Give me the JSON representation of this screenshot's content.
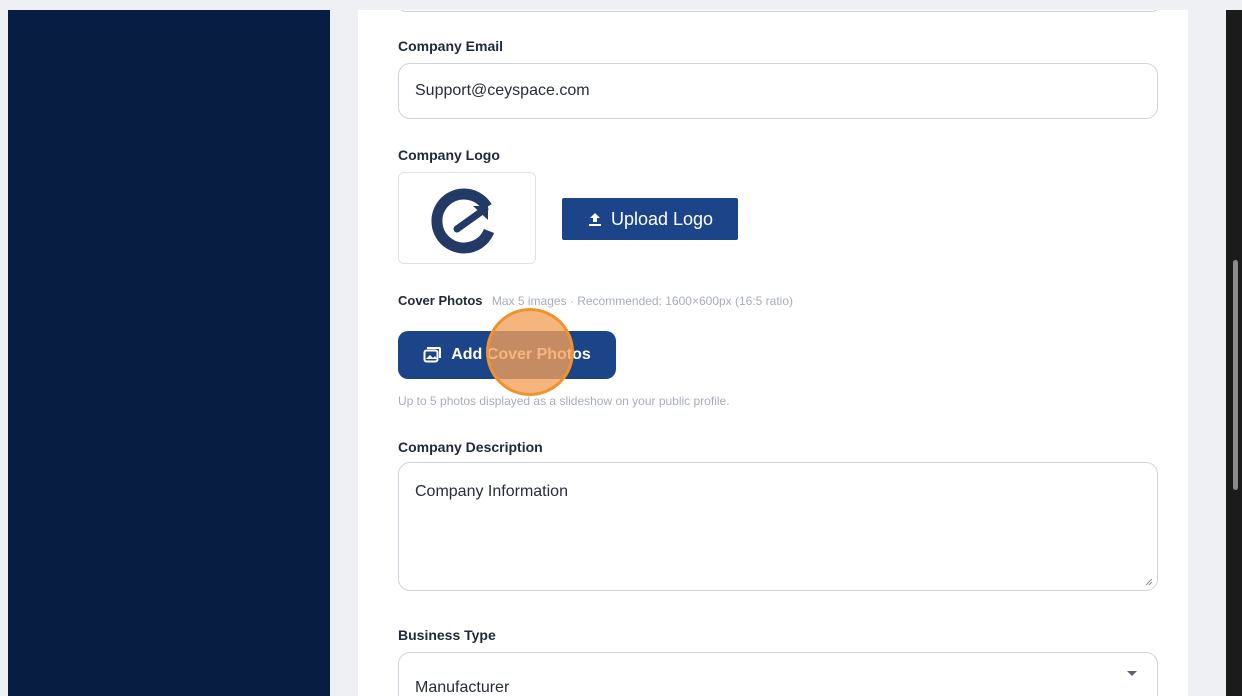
{
  "form": {
    "email": {
      "label": "Company Email",
      "value": "Support@ceyspace.com"
    },
    "logo": {
      "label": "Company Logo",
      "upload_label": "Upload Logo"
    },
    "cover": {
      "label": "Cover Photos",
      "hint": "Max 5 images · Recommended: 1600×600px (16:5 ratio)",
      "button_label": "Add Cover Photos",
      "help": "Up to 5 photos displayed as a slideshow on your public profile."
    },
    "description": {
      "label": "Company Description",
      "value": "Company Information"
    },
    "business_type": {
      "label": "Business Type",
      "value": "Manufacturer"
    }
  },
  "colors": {
    "sidebar": "#081d42",
    "primary_button": "#1c4489",
    "click_indicator": "#f0922e"
  },
  "icons": {
    "logo": "company-logo-icon",
    "upload": "upload-icon",
    "photos": "photos-icon",
    "caret": "chevron-down-icon"
  }
}
